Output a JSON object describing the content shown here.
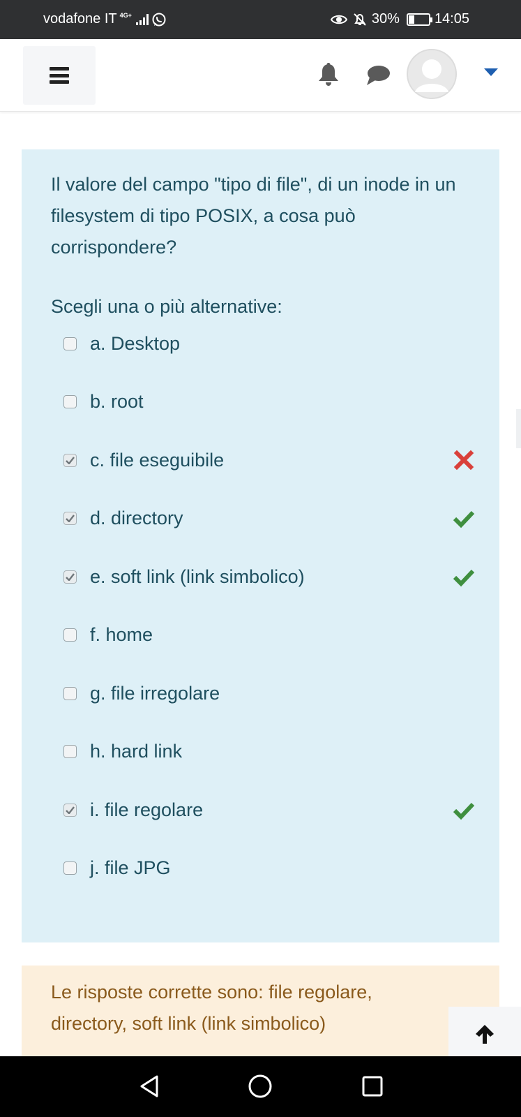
{
  "status_bar": {
    "carrier": "vodafone IT",
    "network": "4G+",
    "battery_percent": "30%",
    "battery_level": 0.3,
    "time": "14:05",
    "icons": [
      "signal-icon",
      "whatsapp-icon",
      "eye-icon",
      "alarm-off-icon",
      "battery-icon"
    ]
  },
  "header": {
    "icons": [
      "menu-icon",
      "bell-icon",
      "chat-icon",
      "avatar",
      "caret-down-icon"
    ]
  },
  "question": {
    "text": "Il valore del campo \"tipo di file\", di un inode in un filesystem di tipo POSIX, a cosa può corrispondere?",
    "prompt": "Scegli una o più alternative:",
    "options": [
      {
        "label": "a. Desktop",
        "checked": false,
        "result": ""
      },
      {
        "label": "b. root",
        "checked": false,
        "result": ""
      },
      {
        "label": "c. file eseguibile",
        "checked": true,
        "result": "incorrect"
      },
      {
        "label": "d. directory",
        "checked": true,
        "result": "correct"
      },
      {
        "label": "e. soft link (link simbolico)",
        "checked": true,
        "result": "correct"
      },
      {
        "label": "f. home",
        "checked": false,
        "result": ""
      },
      {
        "label": "g. file irregolare",
        "checked": false,
        "result": ""
      },
      {
        "label": "h. hard link",
        "checked": false,
        "result": ""
      },
      {
        "label": "i. file regolare",
        "checked": true,
        "result": "correct"
      },
      {
        "label": "j. file JPG",
        "checked": false,
        "result": ""
      }
    ]
  },
  "feedback": {
    "text": "Le risposte corrette sono: file regolare, directory, soft link (link simbolico)"
  },
  "colors": {
    "status_bar_bg": "#2f3032",
    "question_bg": "#def0f7",
    "question_text": "#1f4f5f",
    "feedback_bg": "#fcefdc",
    "feedback_text": "#8a5a1c",
    "correct": "#3f8f3f",
    "incorrect": "#d9403a",
    "accent": "#1e5fb0"
  },
  "nav": {
    "icons": [
      "back-icon",
      "home-icon",
      "recent-apps-icon"
    ]
  }
}
